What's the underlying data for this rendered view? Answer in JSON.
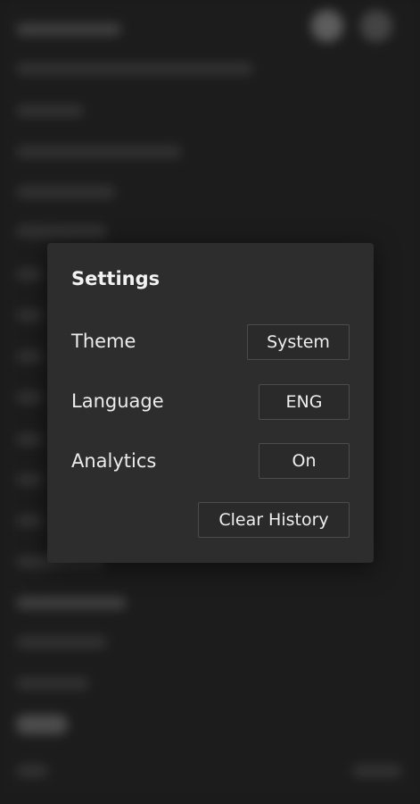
{
  "settings_modal": {
    "title": "Settings",
    "rows": [
      {
        "label": "Theme",
        "value": "System"
      },
      {
        "label": "Language",
        "value": "ENG"
      },
      {
        "label": "Analytics",
        "value": "On"
      }
    ],
    "clear_history_label": "Clear History"
  }
}
